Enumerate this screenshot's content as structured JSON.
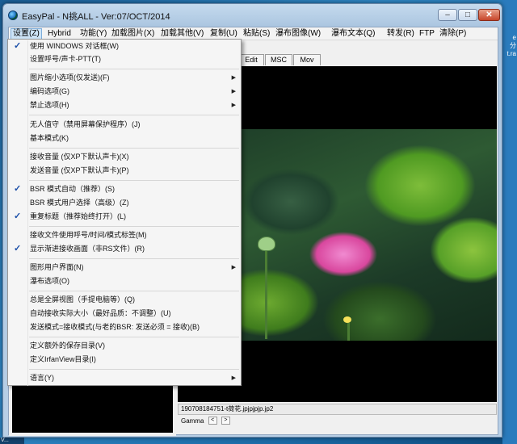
{
  "window": {
    "title": "EasyPal - N挑ALL - Ver:07/OCT/2014",
    "minimize_glyph": "–",
    "maximize_glyph": "□",
    "close_glyph": "✕"
  },
  "menubar": [
    {
      "label": "设置(Z)"
    },
    {
      "label": "Hybrid"
    },
    {
      "label": "功能(Y)"
    },
    {
      "label": "加载图片(X)"
    },
    {
      "label": "加载其他(V)"
    },
    {
      "label": "复制(U)"
    },
    {
      "label": "粘贴(S)"
    },
    {
      "label": "瀑布图像(W)"
    },
    {
      "label": "瀑布文本(Q)"
    },
    {
      "label": "转发(R)"
    },
    {
      "label": "FTP"
    },
    {
      "label": "清除(P)"
    }
  ],
  "tabs": [
    {
      "label": "Edit"
    },
    {
      "label": "MSC"
    },
    {
      "label": "Mov"
    }
  ],
  "settings_menu": {
    "items": [
      {
        "label": "使用 WINDOWS 对话框(W)",
        "checked": true,
        "submenu": false
      },
      {
        "label": "设置呼号/声卡-PTT(T)",
        "checked": false,
        "submenu": false
      },
      {
        "label": "图片缩小选项(仅发送)(F)",
        "checked": false,
        "submenu": true
      },
      {
        "label": "编码选项(G)",
        "checked": false,
        "submenu": true
      },
      {
        "label": "禁止选项(H)",
        "checked": false,
        "submenu": true
      },
      {
        "label": "无人值守（禁用屏幕保护程序）(J)",
        "checked": false,
        "submenu": false
      },
      {
        "label": "基本模式(K)",
        "checked": false,
        "submenu": false
      },
      {
        "label": "接收音量 (仅XP下默认声卡)(X)",
        "checked": false,
        "submenu": false
      },
      {
        "label": "发送音量 (仅XP下默认声卡)(P)",
        "checked": false,
        "submenu": false
      },
      {
        "label": "BSR 模式自动（推荐）(S)",
        "checked": true,
        "submenu": false
      },
      {
        "label": "BSR 模式用户选择（高级）(Z)",
        "checked": false,
        "submenu": false
      },
      {
        "label": "重复标题（推荐始终打开）(L)",
        "checked": true,
        "submenu": false
      },
      {
        "label": "接收文件使用呼号/时间/模式标签(M)",
        "checked": false,
        "submenu": false
      },
      {
        "label": "显示渐进接收画面（非RS文件）(R)",
        "checked": true,
        "submenu": false
      },
      {
        "label": "图形用户界面(N)",
        "checked": false,
        "submenu": true
      },
      {
        "label": "瀑布选项(O)",
        "checked": false,
        "submenu": false
      },
      {
        "label": "总是全屏视图（手提电脑等）(Q)",
        "checked": false,
        "submenu": false
      },
      {
        "label": "自动接收实际大小（最好品质：不调整）(U)",
        "checked": false,
        "submenu": false
      },
      {
        "label": "发送模式=接收模式(与老的BSR: 发送必须 = 接收)(B)",
        "checked": false,
        "submenu": false
      },
      {
        "label": "定义额外的保存目录(V)",
        "checked": false,
        "submenu": false
      },
      {
        "label": "定义IrfanView目录(I)",
        "checked": false,
        "submenu": false
      },
      {
        "label": "语言(Y)",
        "checked": false,
        "submenu": true
      }
    ],
    "check_glyph": "✓",
    "arrow_glyph": "▶"
  },
  "image": {
    "filename": "190708184751-t荷花.jpjpjpjp.jp2"
  },
  "gamma": {
    "label": "Gamma",
    "dec_glyph": "<",
    "inc_glyph": ">"
  },
  "desktop": {
    "right_text": [
      "e",
      "分",
      "t.ra"
    ],
    "taskbar_text": "V..."
  },
  "left_strip": {
    "text": "25"
  },
  "colors": {
    "menu_highlight": "#cde4f7",
    "check": "#1a4ea8",
    "close_button": "#c7452a"
  }
}
